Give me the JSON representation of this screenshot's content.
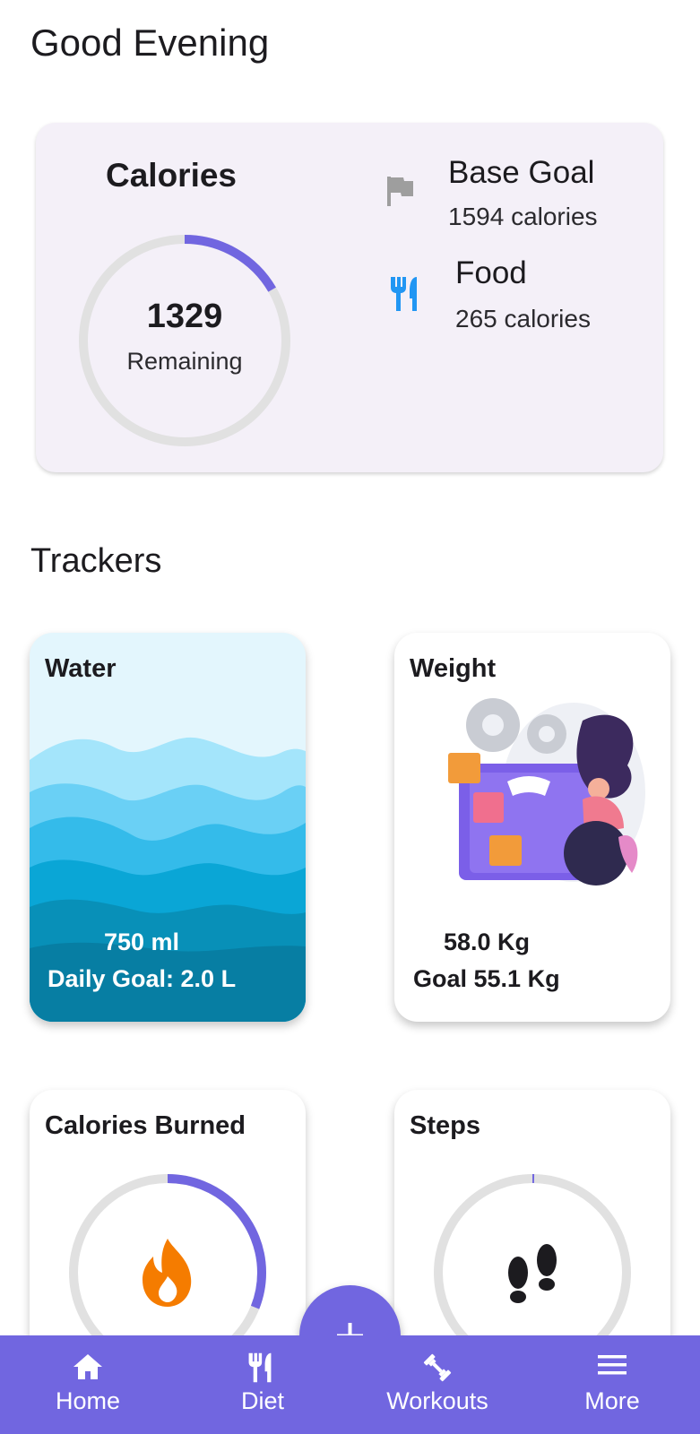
{
  "greeting": "Good Evening",
  "calories_card": {
    "title": "Calories",
    "remaining_value": "1329",
    "remaining_label": "Remaining",
    "progress_fraction": 0.166,
    "base_goal": {
      "title": "Base Goal",
      "value": "1594 calories",
      "icon": "flag-icon"
    },
    "food": {
      "title": "Food",
      "value": "265 calories",
      "icon": "fork-knife-icon"
    }
  },
  "trackers_title": "Trackers",
  "trackers": {
    "water": {
      "title": "Water",
      "amount": "750 ml",
      "goal": "Daily Goal: 2.0 L"
    },
    "weight": {
      "title": "Weight",
      "current": "58.0 Kg",
      "goal": "Goal 55.1 Kg"
    },
    "calories_burned": {
      "title": "Calories Burned",
      "progress_fraction": 0.31,
      "icon": "flame-icon"
    },
    "steps": {
      "title": "Steps",
      "progress_fraction": 0.002,
      "icon": "footprints-icon"
    }
  },
  "nav": {
    "home": "Home",
    "diet": "Diet",
    "workouts": "Workouts",
    "more": "More"
  },
  "colors": {
    "accent": "#7166e0",
    "ring_track": "#e1e1e1",
    "card_bg": "#f4f0f8",
    "food_icon": "#2196f3",
    "flame": "#f57c00"
  }
}
